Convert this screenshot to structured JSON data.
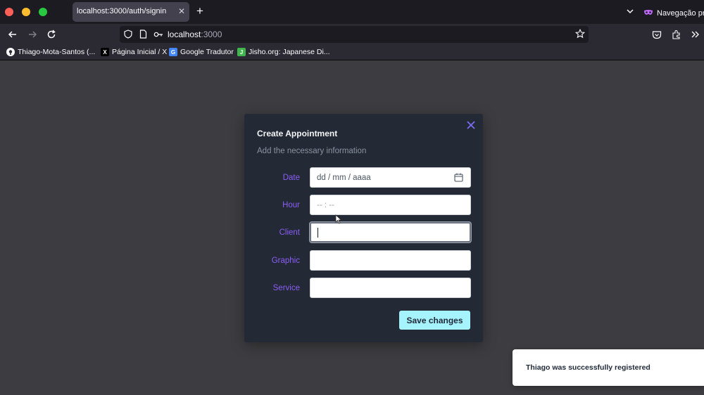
{
  "browser": {
    "tab_title": "localhost:3000/auth/signin",
    "private_label": "Navegação privada",
    "url_host": "localhost",
    "url_port": ":3000",
    "bookmarks": [
      {
        "label": "Thiago-Mota-Santos (..."
      },
      {
        "label": "Página Inicial / X"
      },
      {
        "label": "Google Tradutor"
      },
      {
        "label": "Jisho.org: Japanese Di..."
      }
    ]
  },
  "modal": {
    "title": "Create Appointment",
    "description": "Add the necessary information",
    "fields": [
      {
        "label": "Date",
        "placeholder": "dd / mm / aaaa"
      },
      {
        "label": "Hour",
        "placeholder": "-- : --"
      },
      {
        "label": "Client",
        "value": ""
      },
      {
        "label": "Graphic",
        "value": ""
      },
      {
        "label": "Service",
        "value": ""
      }
    ],
    "save_label": "Save changes"
  },
  "toast": {
    "message": "Thiago was successfully registered"
  },
  "colors": {
    "label": "#8b5cf6",
    "close": "#7c6cf0",
    "save_button": "#a5f3fc",
    "modal_bg": "#232a35",
    "page_bg": "#3d3c40"
  }
}
